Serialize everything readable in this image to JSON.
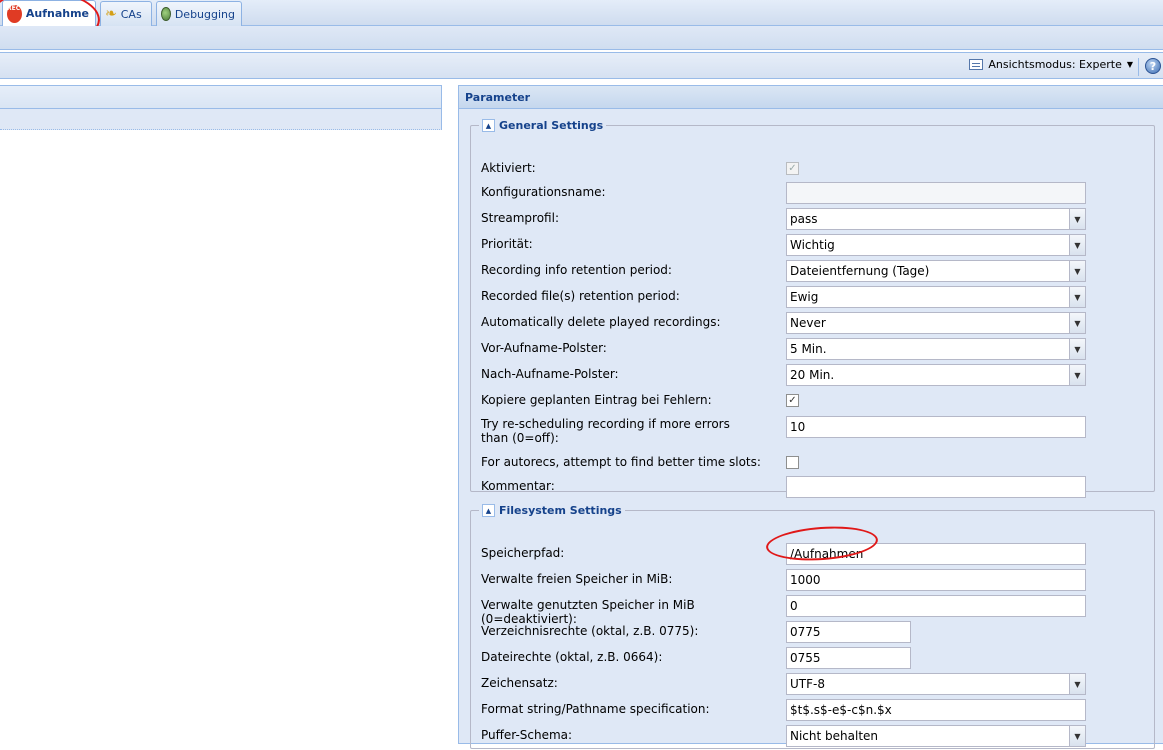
{
  "tabs": [
    {
      "label": "Aufnahme",
      "icon": "rec-icon"
    },
    {
      "label": "CAs",
      "icon": "key-icon"
    },
    {
      "label": "Debugging",
      "icon": "debug-icon"
    }
  ],
  "toolbar": {
    "view_mode_label": "Ansichtsmodus: Experte",
    "help": "?"
  },
  "params_panel": {
    "title": "Parameter"
  },
  "general": {
    "title": "General Settings",
    "fields": {
      "aktiviert": {
        "label": "Aktiviert:"
      },
      "konfigname": {
        "label": "Konfigurationsname:",
        "value": ""
      },
      "streamprofil": {
        "label": "Streamprofil:",
        "value": "pass"
      },
      "prioritaet": {
        "label": "Priorität:",
        "value": "Wichtig"
      },
      "info_retention": {
        "label": "Recording info retention period:",
        "value": "Dateientfernung (Tage)"
      },
      "file_retention": {
        "label": "Recorded file(s) retention period:",
        "value": "Ewig"
      },
      "auto_delete": {
        "label": "Automatically delete played recordings:",
        "value": "Never"
      },
      "vor_polster": {
        "label": "Vor-Aufname-Polster:",
        "value": "5 Min."
      },
      "nach_polster": {
        "label": "Nach-Aufname-Polster:",
        "value": "20 Min."
      },
      "kopiere": {
        "label": "Kopiere geplanten Eintrag bei Fehlern:"
      },
      "rescheduling": {
        "label": "Try re-scheduling recording if more errors than (0=off):",
        "value": "10"
      },
      "autorecs": {
        "label": "For autorecs, attempt to find better time slots:"
      },
      "kommentar": {
        "label": "Kommentar:",
        "value": ""
      }
    }
  },
  "filesystem": {
    "title": "Filesystem Settings",
    "fields": {
      "speicherpfad": {
        "label": "Speicherpfad:",
        "value": "/Aufnahmen"
      },
      "frei": {
        "label": "Verwalte freien Speicher in MiB:",
        "value": "1000"
      },
      "genutzt": {
        "label": "Verwalte genutzten Speicher in MiB (0=deaktiviert):",
        "value": "0"
      },
      "verzrechte": {
        "label": "Verzeichnisrechte (oktal, z.B. 0775):",
        "value": "0775"
      },
      "dateirechte": {
        "label": "Dateirechte (oktal, z.B. 0664):",
        "value": "0755"
      },
      "zeichensatz": {
        "label": "Zeichensatz:",
        "value": "UTF-8"
      },
      "format": {
        "label": "Format string/Pathname specification:",
        "value": "$t$.s$-e$-c$n.$x"
      },
      "puffer": {
        "label": "Puffer-Schema:",
        "value": "Nicht behalten"
      }
    }
  }
}
